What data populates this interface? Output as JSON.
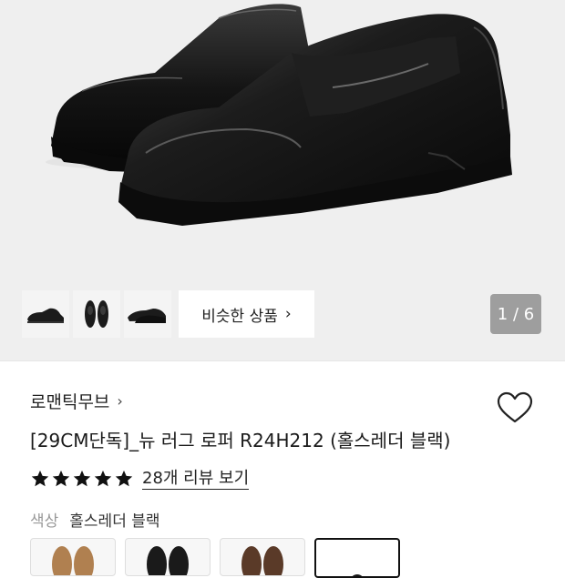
{
  "gallery": {
    "similar_label": "비슷한 상품",
    "similar_chevron": "›",
    "counter": "1 / 6",
    "thumbnails": [
      "side-view",
      "front-view",
      "three-quarter-view"
    ]
  },
  "product": {
    "brand": "로맨틱무브",
    "brand_chevron": "›",
    "title": "[29CM단독]_뉴 러그 로퍼 R24H212 (홀스레더 블랙)",
    "rating": 5,
    "review_link": "28개 리뷰 보기",
    "color_label": "색상",
    "color_value": "홀스레더 블랙"
  },
  "swatches": [
    {
      "name": "tan",
      "color": "#b08050"
    },
    {
      "name": "black",
      "color": "#1a1a1a"
    },
    {
      "name": "brown",
      "color": "#5a3a28"
    },
    {
      "name": "selected-black",
      "color": "#1a1a1a"
    }
  ],
  "colors": {
    "star": "#111111",
    "counter_bg": "#9e9e9e",
    "gallery_bg": "#efefef"
  }
}
